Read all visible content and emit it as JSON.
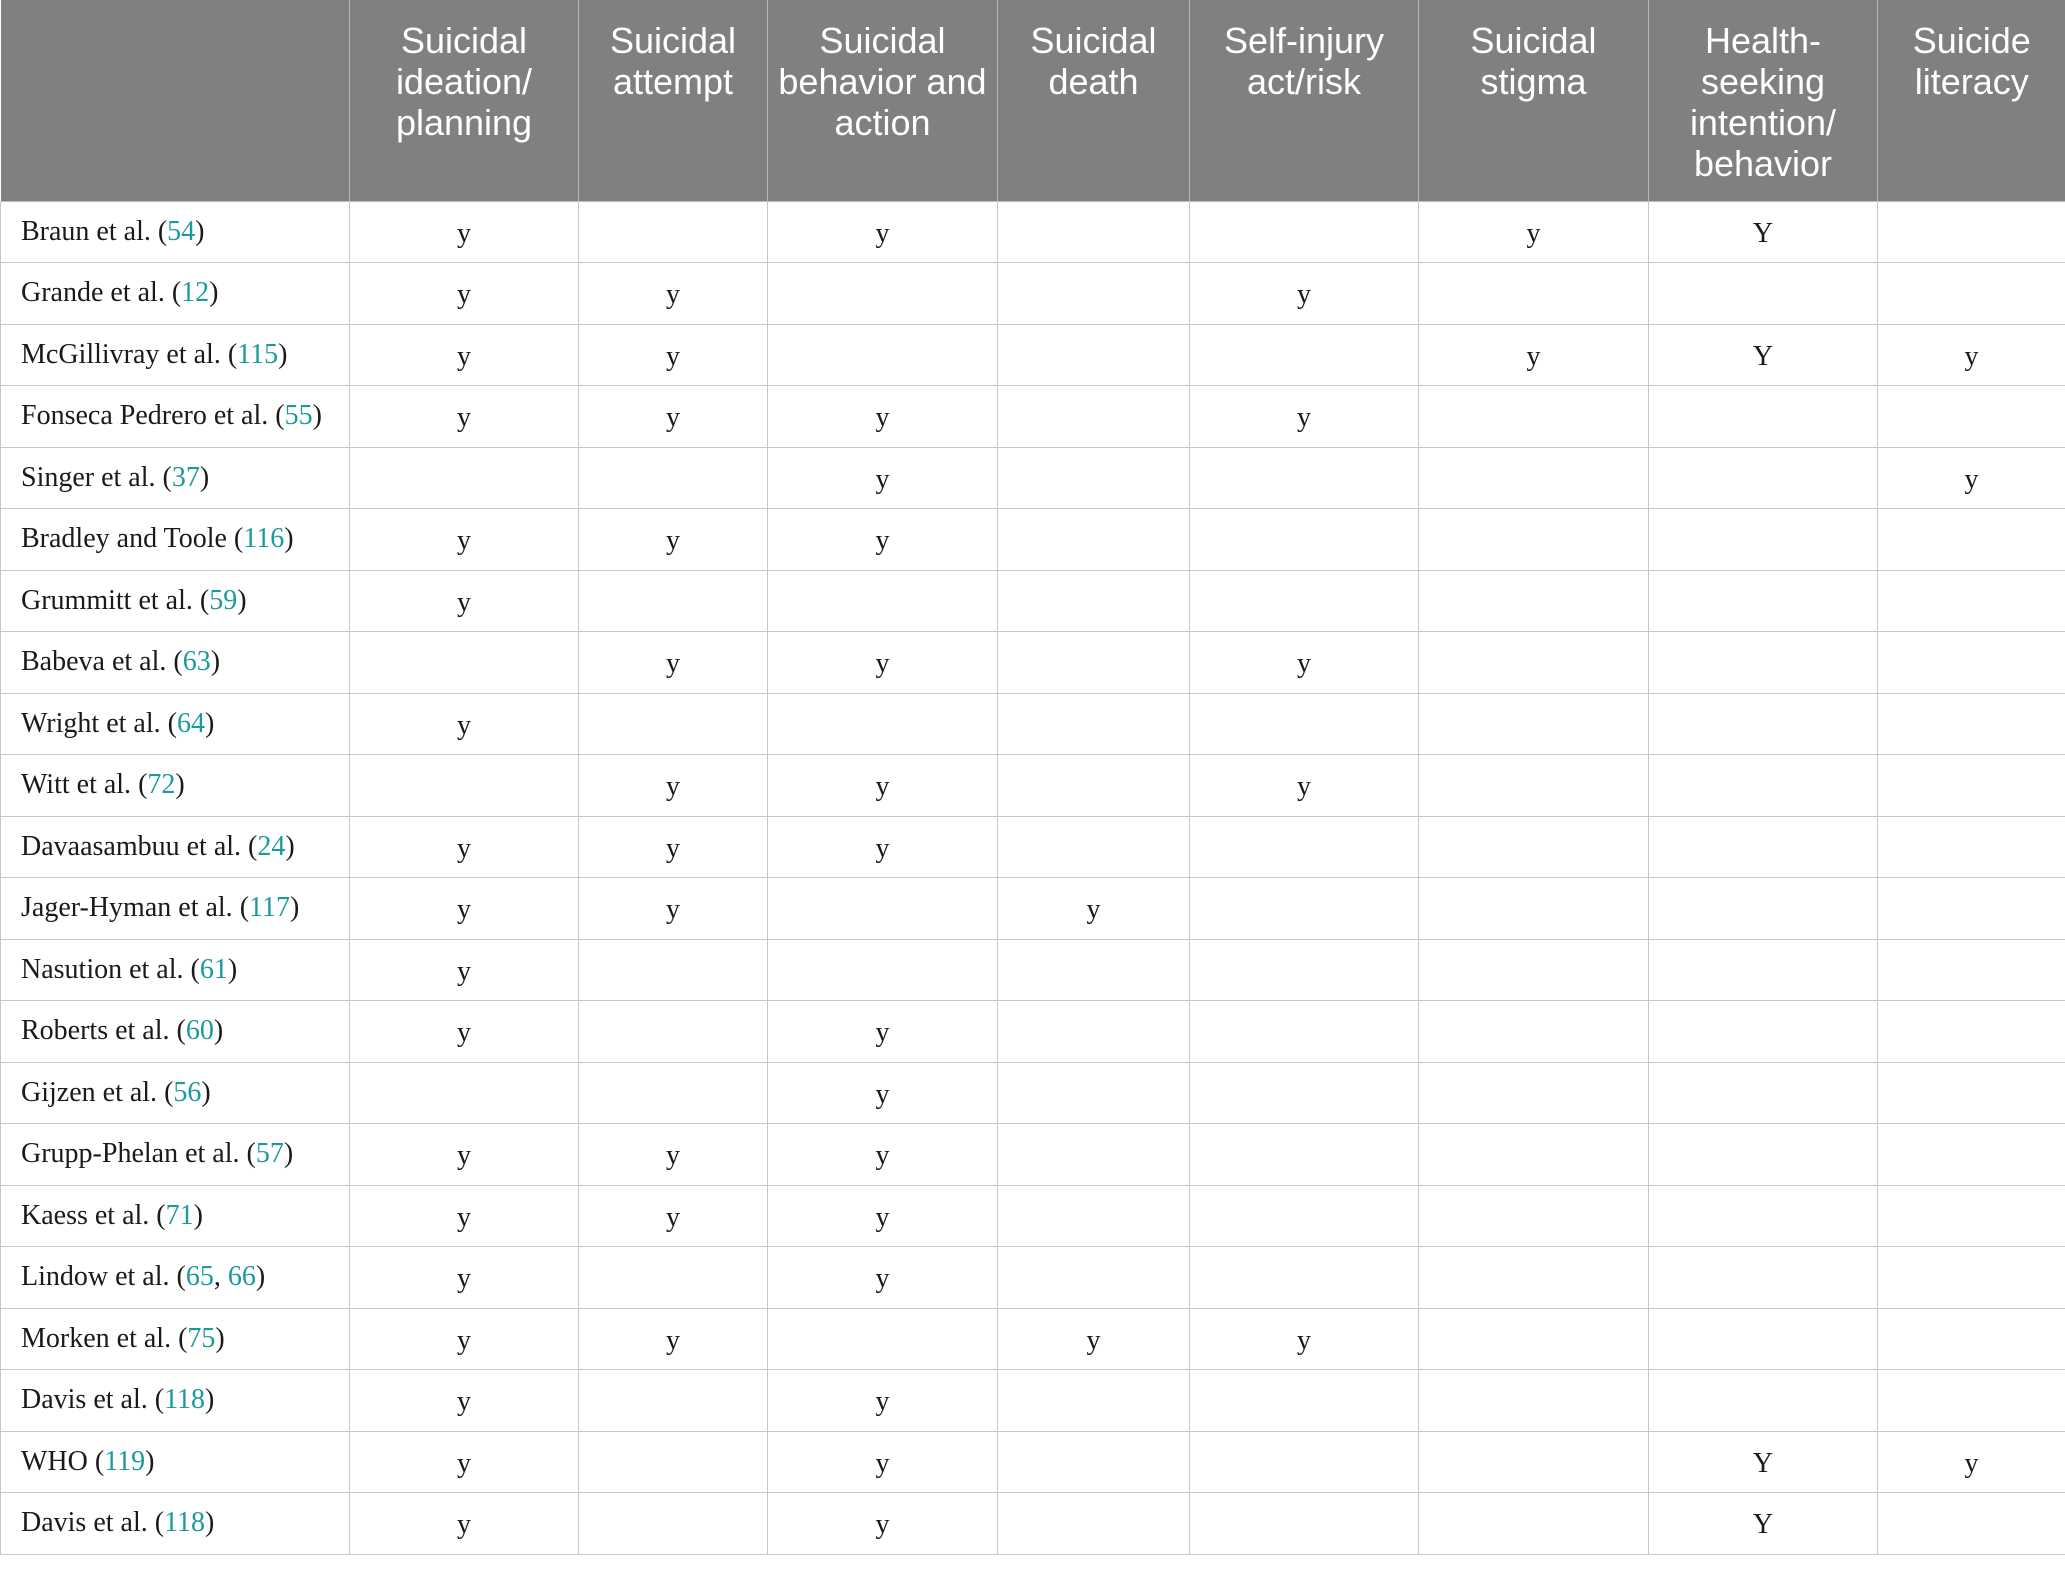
{
  "table": {
    "headers": [
      "",
      "Suicidal ideation/ planning",
      "Suicidal attempt",
      "Suicidal behavior and action",
      "Suicidal death",
      "Self-injury act/risk",
      "Suicidal stigma",
      "Health-seeking intention/ behavior",
      "Suicide literacy"
    ],
    "rows": [
      {
        "study": "Braun et al.",
        "refs": [
          "54"
        ],
        "cells": [
          "y",
          "",
          "y",
          "",
          "",
          "y",
          "Y",
          ""
        ]
      },
      {
        "study": "Grande et al.",
        "refs": [
          "12"
        ],
        "cells": [
          "y",
          "y",
          "",
          "",
          "y",
          "",
          "",
          ""
        ]
      },
      {
        "study": "McGillivray et al.",
        "refs": [
          "115"
        ],
        "cells": [
          "y",
          "y",
          "",
          "",
          "",
          "y",
          "Y",
          "y"
        ]
      },
      {
        "study": "Fonseca Pedrero et al.",
        "refs": [
          "55"
        ],
        "cells": [
          "y",
          "y",
          "y",
          "",
          "y",
          "",
          "",
          ""
        ]
      },
      {
        "study": "Singer et al.",
        "refs": [
          "37"
        ],
        "cells": [
          "",
          "",
          "y",
          "",
          "",
          "",
          "",
          "y"
        ]
      },
      {
        "study": "Bradley and Toole",
        "refs": [
          "116"
        ],
        "cells": [
          "y",
          "y",
          "y",
          "",
          "",
          "",
          "",
          ""
        ]
      },
      {
        "study": "Grummitt et al.",
        "refs": [
          "59"
        ],
        "cells": [
          "y",
          "",
          "",
          "",
          "",
          "",
          "",
          ""
        ]
      },
      {
        "study": "Babeva et al.",
        "refs": [
          "63"
        ],
        "cells": [
          "",
          "y",
          "y",
          "",
          "y",
          "",
          "",
          ""
        ]
      },
      {
        "study": "Wright et al.",
        "refs": [
          "64"
        ],
        "cells": [
          "y",
          "",
          "",
          "",
          "",
          "",
          "",
          ""
        ]
      },
      {
        "study": "Witt et al.",
        "refs": [
          "72"
        ],
        "cells": [
          "",
          "y",
          "y",
          "",
          "y",
          "",
          "",
          ""
        ]
      },
      {
        "study": "Davaasambuu et al.",
        "refs": [
          "24"
        ],
        "cells": [
          "y",
          "y",
          "y",
          "",
          "",
          "",
          "",
          ""
        ]
      },
      {
        "study": "Jager-Hyman et al.",
        "refs": [
          "117"
        ],
        "cells": [
          "y",
          "y",
          "",
          "y",
          "",
          "",
          "",
          ""
        ]
      },
      {
        "study": "Nasution et al.",
        "refs": [
          "61"
        ],
        "cells": [
          "y",
          "",
          "",
          "",
          "",
          "",
          "",
          ""
        ]
      },
      {
        "study": "Roberts et al.",
        "refs": [
          "60"
        ],
        "cells": [
          "y",
          "",
          "y",
          "",
          "",
          "",
          "",
          ""
        ]
      },
      {
        "study": "Gijzen et al.",
        "refs": [
          "56"
        ],
        "cells": [
          "",
          "",
          "y",
          "",
          "",
          "",
          "",
          ""
        ]
      },
      {
        "study": "Grupp-Phelan et al.",
        "refs": [
          "57"
        ],
        "cells": [
          "y",
          "y",
          "y",
          "",
          "",
          "",
          "",
          ""
        ]
      },
      {
        "study": "Kaess et al.",
        "refs": [
          "71"
        ],
        "cells": [
          "y",
          "y",
          "y",
          "",
          "",
          "",
          "",
          ""
        ]
      },
      {
        "study": "Lindow et al.",
        "refs": [
          "65",
          "66"
        ],
        "cells": [
          "y",
          "",
          "y",
          "",
          "",
          "",
          "",
          ""
        ]
      },
      {
        "study": "Morken et al.",
        "refs": [
          "75"
        ],
        "cells": [
          "y",
          "y",
          "",
          "y",
          "y",
          "",
          "",
          ""
        ]
      },
      {
        "study": "Davis et al.",
        "refs": [
          "118"
        ],
        "cells": [
          "y",
          "",
          "y",
          "",
          "",
          "",
          "",
          ""
        ]
      },
      {
        "study": "WHO",
        "refs": [
          "119"
        ],
        "cells": [
          "y",
          "",
          "y",
          "",
          "",
          "",
          "Y",
          "y"
        ]
      },
      {
        "study": "Davis et al.",
        "refs": [
          "118"
        ],
        "cells": [
          "y",
          "",
          "y",
          "",
          "",
          "",
          "Y",
          ""
        ]
      }
    ]
  },
  "colors": {
    "header_bg": "#808080",
    "header_text": "#ffffff",
    "reference_link": "#1b9a9e",
    "grid_line": "#c8c8c8"
  }
}
